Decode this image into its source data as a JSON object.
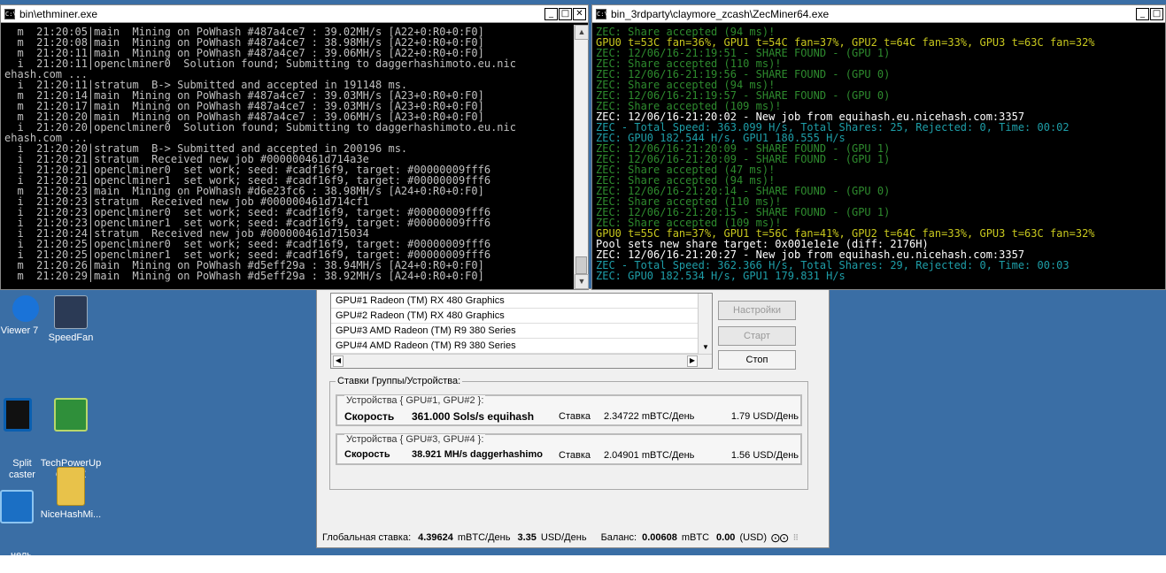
{
  "ethminer": {
    "title": "bin\\ethminer.exe",
    "lines": [
      "  m  21:20:05|main  Mining on PoWhash #487a4ce7 : 39.02MH/s [A22+0:R0+0:F0]",
      "  m  21:20:08|main  Mining on PoWhash #487a4ce7 : 38.98MH/s [A22+0:R0+0:F0]",
      "  m  21:20:11|main  Mining on PoWhash #487a4ce7 : 39.06MH/s [A22+0:R0+0:F0]",
      "  i  21:20:11|openclminer0  Solution found; Submitting to daggerhashimoto.eu.nic",
      "ehash.com ...",
      "  i  21:20:11|stratum  B-> Submitted and accepted in 191148 ms.",
      "  m  21:20:14|main  Mining on PoWhash #487a4ce7 : 39.03MH/s [A23+0:R0+0:F0]",
      "  m  21:20:17|main  Mining on PoWhash #487a4ce7 : 39.03MH/s [A23+0:R0+0:F0]",
      "  m  21:20:20|main  Mining on PoWhash #487a4ce7 : 39.06MH/s [A23+0:R0+0:F0]",
      "  i  21:20:20|openclminer0  Solution found; Submitting to daggerhashimoto.eu.nic",
      "ehash.com ...",
      "  i  21:20:20|stratum  B-> Submitted and accepted in 200196 ms.",
      "  i  21:20:21|stratum  Received new job #000000461d714a3e",
      "  i  21:20:21|openclminer0  set work; seed: #cadf16f9, target: #00000009fff6",
      "  i  21:20:21|openclminer1  set work; seed: #cadf16f9, target: #00000009fff6",
      "  m  21:20:23|main  Mining on PoWhash #d6e23fc6 : 38.98MH/s [A24+0:R0+0:F0]",
      "  i  21:20:23|stratum  Received new job #000000461d714cf1",
      "  i  21:20:23|openclminer0  set work; seed: #cadf16f9, target: #00000009fff6",
      "  i  21:20:23|openclminer1  set work; seed: #cadf16f9, target: #00000009fff6",
      "  i  21:20:24|stratum  Received new job #000000461d715034",
      "  i  21:20:25|openclminer0  set work; seed: #cadf16f9, target: #00000009fff6",
      "  i  21:20:25|openclminer1  set work; seed: #cadf16f9, target: #00000009fff6",
      "  m  21:20:26|main  Mining on PoWhash #d5eff29a : 38.94MH/s [A24+0:R0+0:F0]",
      "  m  21:20:29|main  Mining on PoWhash #d5eff29a : 38.92MH/s [A24+0:R0+0:F0]"
    ]
  },
  "zec": {
    "title": "bin_3rdparty\\claymore_zcash\\ZecMiner64.exe",
    "lines": [
      {
        "t": "ZEC: Share accepted (94 ms)!",
        "c": "#2e8b2e"
      },
      {
        "t": "GPU0 t=53C fan=36%, GPU1 t=54C fan=37%, GPU2 t=64C fan=33%, GPU3 t=63C fan=32%",
        "c": "#c8c81e"
      },
      {
        "t": "ZEC: 12/06/16-21:19:51 - SHARE FOUND - (GPU 1)",
        "c": "#2e8b2e"
      },
      {
        "t": "ZEC: Share accepted (110 ms)!",
        "c": "#2e8b2e"
      },
      {
        "t": "ZEC: 12/06/16-21:19:56 - SHARE FOUND - (GPU 0)",
        "c": "#2e8b2e"
      },
      {
        "t": "ZEC: Share accepted (94 ms)!",
        "c": "#2e8b2e"
      },
      {
        "t": "ZEC: 12/06/16-21:19:57 - SHARE FOUND - (GPU 0)",
        "c": "#2e8b2e"
      },
      {
        "t": "ZEC: Share accepted (109 ms)!",
        "c": "#2e8b2e"
      },
      {
        "t": "ZEC: 12/06/16-21:20:02 - New job from equihash.eu.nicehash.com:3357",
        "c": "#ffffff"
      },
      {
        "t": "ZEC - Total Speed: 363.099 H/s, Total Shares: 25, Rejected: 0, Time: 00:02",
        "c": "#1e9ea8"
      },
      {
        "t": "ZEC: GPU0 182.544 H/s, GPU1 180.555 H/s",
        "c": "#1e9ea8"
      },
      {
        "t": "ZEC: 12/06/16-21:20:09 - SHARE FOUND - (GPU 1)",
        "c": "#2e8b2e"
      },
      {
        "t": "ZEC: 12/06/16-21:20:09 - SHARE FOUND - (GPU 1)",
        "c": "#2e8b2e"
      },
      {
        "t": "ZEC: Share accepted (47 ms)!",
        "c": "#2e8b2e"
      },
      {
        "t": "ZEC: Share accepted (94 ms)!",
        "c": "#2e8b2e"
      },
      {
        "t": "ZEC: 12/06/16-21:20:14 - SHARE FOUND - (GPU 0)",
        "c": "#2e8b2e"
      },
      {
        "t": "ZEC: Share accepted (110 ms)!",
        "c": "#2e8b2e"
      },
      {
        "t": "ZEC: 12/06/16-21:20:15 - SHARE FOUND - (GPU 1)",
        "c": "#2e8b2e"
      },
      {
        "t": "ZEC: Share accepted (109 ms)!",
        "c": "#2e8b2e"
      },
      {
        "t": "GPU0 t=55C fan=37%, GPU1 t=56C fan=41%, GPU2 t=64C fan=33%, GPU3 t=63C fan=32%",
        "c": "#c8c81e"
      },
      {
        "t": "Pool sets new share target: 0x001e1e1e (diff: 2176H)",
        "c": "#ffffff"
      },
      {
        "t": "ZEC: 12/06/16-21:20:27 - New job from equihash.eu.nicehash.com:3357",
        "c": "#ffffff"
      },
      {
        "t": "ZEC - Total Speed: 362.366 H/s, Total Shares: 29, Rejected: 0, Time: 00:03",
        "c": "#1e9ea8"
      },
      {
        "t": "ZEC: GPU0 182.534 H/s, GPU1 179.831 H/s",
        "c": "#1e9ea8"
      }
    ]
  },
  "desktop_icons": [
    {
      "label": "Viewer 7",
      "icon": "teamviewer-icon"
    },
    {
      "label": "SpeedFan",
      "icon": "speedfan-icon"
    },
    {
      "label": "Split\ncaster",
      "icon": "splitcaster-icon"
    },
    {
      "label": "TechPowerUp\nGPU-Z",
      "icon": "gpuz-icon"
    },
    {
      "label": "нель\nлени...",
      "icon": "intel-panel-icon"
    },
    {
      "label": "NiceHashMi...",
      "icon": "folder-icon"
    }
  ],
  "nicehash": {
    "devices": [
      "GPU#1 Radeon (TM) RX 480 Graphics",
      "GPU#2 Radeon (TM) RX 480 Graphics",
      "GPU#3 AMD Radeon (TM) R9 380 Series",
      "GPU#4 AMD Radeon (TM) R9 380 Series"
    ],
    "buttons": {
      "settings": "Настройки",
      "start": "Старт",
      "stop": "Стоп"
    },
    "rates_group_label": "Ставки Группы/Устройства:",
    "groups": [
      {
        "label": "Устройства { GPU#1, GPU#2 }:",
        "speed_label": "Скорость",
        "speed": "361.000 Sols/s equihash",
        "rate_label": "Ставка",
        "rate": "2.34722 mBTC/День",
        "usd": "1.79 USD/День"
      },
      {
        "label": "Устройства { GPU#3, GPU#4 }:",
        "speed_label": "Скорость",
        "speed": "38.921 MH/s daggerhashimo",
        "rate_label": "Ставка",
        "rate": "2.04901 mBTC/День",
        "usd": "1.56 USD/День"
      }
    ],
    "status": {
      "global_label": "Глобальная ставка:",
      "global_btc": "4.39624",
      "btc_unit": "mBTC/День",
      "global_usd": "3.35",
      "usd_unit": "USD/День",
      "balance_label": "Баланс:",
      "balance_btc": "0.00608",
      "balance_unit": "mBTC",
      "balance_usd": "0.00",
      "balance_usd_unit": "(USD)"
    }
  }
}
